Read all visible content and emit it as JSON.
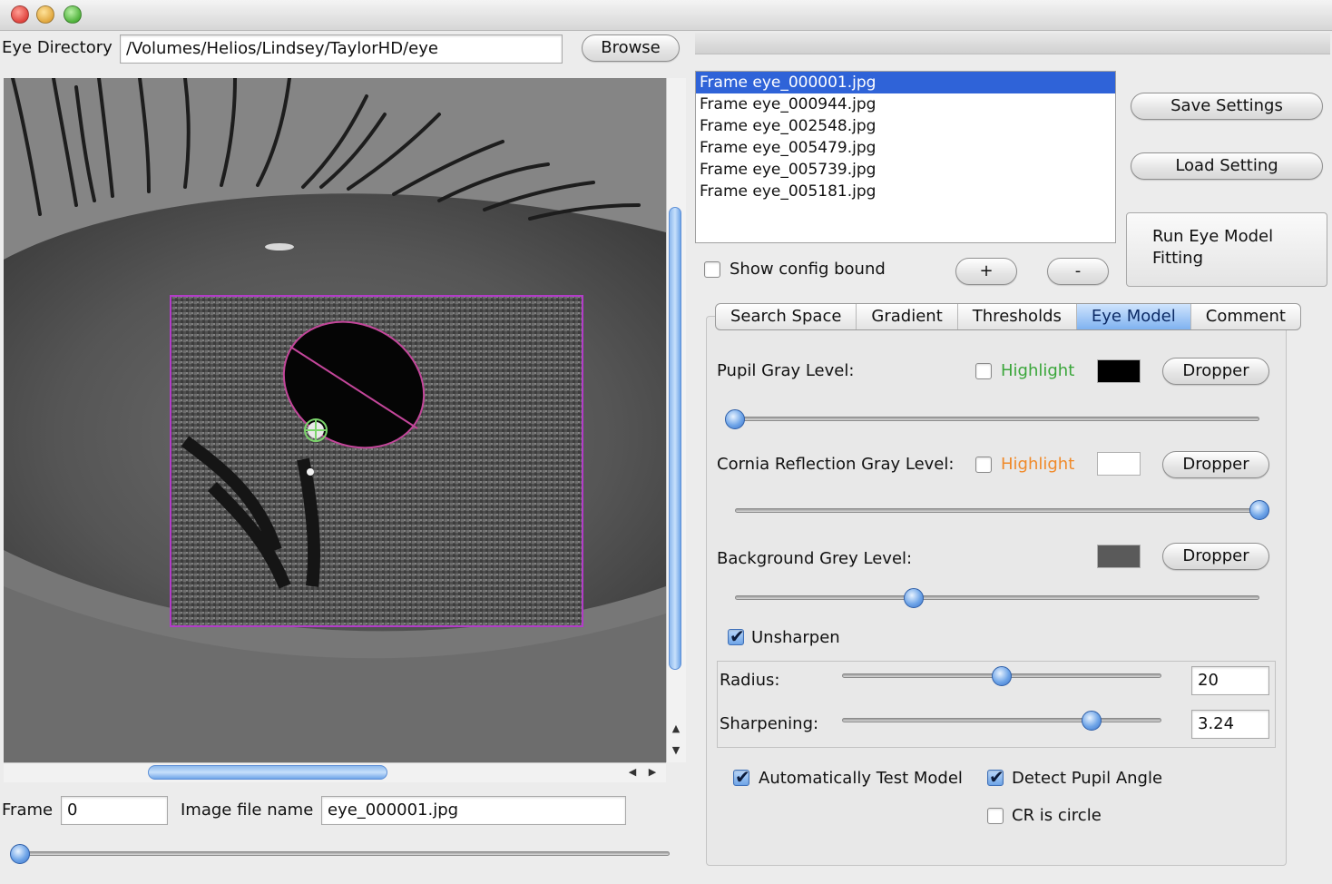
{
  "window": {
    "controls": [
      "close",
      "minimize",
      "zoom"
    ]
  },
  "directory": {
    "label": "Eye Directory",
    "value": "/Volumes/Helios/Lindsey/TaylorHD/eye",
    "browse_label": "Browse"
  },
  "frames": {
    "items": [
      "Frame eye_000001.jpg",
      "Frame eye_000944.jpg",
      "Frame eye_002548.jpg",
      "Frame eye_005479.jpg",
      "Frame eye_005739.jpg",
      "Frame eye_005181.jpg"
    ],
    "selected_index": 0,
    "show_config_label": "Show config bound",
    "show_config_checked": false,
    "add_label": "+",
    "remove_label": "-"
  },
  "actions": {
    "save_label": "Save Settings",
    "load_label": "Load Setting",
    "run_label": "Run Eye Model Fitting"
  },
  "tabs": [
    "Search Space",
    "Gradient",
    "Thresholds",
    "Eye Model",
    "Comment"
  ],
  "selected_tab": "Eye Model",
  "eye_model": {
    "pupil": {
      "label": "Pupil Gray Level:",
      "highlight_label": "Highlight",
      "highlight_checked": false,
      "highlight_color": "#3aa63a",
      "swatch_color": "#000000",
      "dropper_label": "Dropper",
      "slider_fraction": 0.0
    },
    "cornea": {
      "label": "Cornia Reflection Gray Level:",
      "highlight_label": "Highlight",
      "highlight_checked": false,
      "highlight_color": "#f08a2a",
      "swatch_color": "#ffffff",
      "dropper_label": "Dropper",
      "slider_fraction": 1.0
    },
    "background": {
      "label": "Background Grey Level:",
      "swatch_color": "#5a5a5a",
      "dropper_label": "Dropper",
      "slider_fraction": 0.34
    },
    "unsharpen": {
      "label": "Unsharpen",
      "checked": true,
      "radius_label": "Radius:",
      "radius_value": "20",
      "radius_fraction": 0.5,
      "sharpening_label": "Sharpening:",
      "sharpening_value": "3.24",
      "sharpening_fraction": 0.78
    },
    "auto_test": {
      "label": "Automatically Test Model",
      "checked": true
    },
    "detect_angle": {
      "label": "Detect Pupil Angle",
      "checked": true
    },
    "cr_circle": {
      "label": "CR is circle",
      "checked": false
    }
  },
  "bottom": {
    "frame_label": "Frame",
    "frame_value": "0",
    "image_file_label": "Image file name",
    "image_file_value": "eye_000001.jpg",
    "frame_slider_fraction": 0.0
  },
  "colors": {
    "selection": "#2f63d8",
    "overlay": "#b23cc8",
    "accent": "#6fa5e8"
  }
}
